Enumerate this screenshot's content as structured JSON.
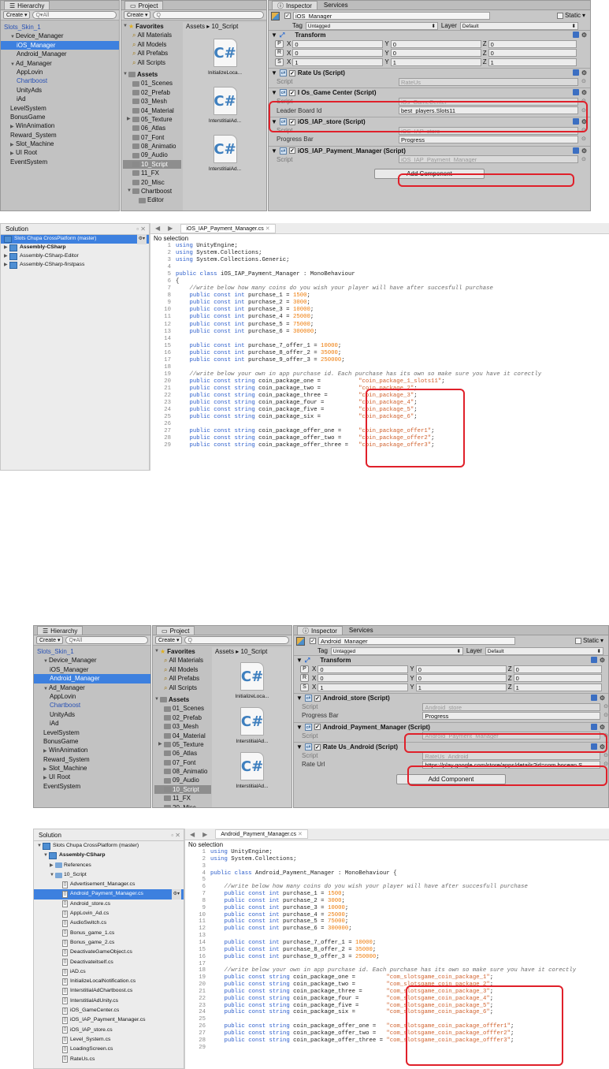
{
  "top": {
    "hierarchy": {
      "tab": "Hierarchy",
      "create": "Create",
      "search": "Q▾All",
      "items": [
        {
          "label": "Slots_Skin_1",
          "indent": 0,
          "style": "blue"
        },
        {
          "label": "Device_Manager",
          "indent": 1,
          "arrow": "▼"
        },
        {
          "label": "iOS_Manager",
          "indent": 2,
          "sel": true
        },
        {
          "label": "Android_Manager",
          "indent": 2
        },
        {
          "label": "Ad_Manager",
          "indent": 1,
          "arrow": "▼"
        },
        {
          "label": "AppLovin",
          "indent": 2
        },
        {
          "label": "Chartboost",
          "indent": 2,
          "style": "blue"
        },
        {
          "label": "UnityAds",
          "indent": 2
        },
        {
          "label": "iAd",
          "indent": 2
        },
        {
          "label": "LevelSystem",
          "indent": 1
        },
        {
          "label": "BonusGame",
          "indent": 1
        },
        {
          "label": "WinAnimation",
          "indent": 1,
          "arrow": "▶"
        },
        {
          "label": "Reward_System",
          "indent": 1
        },
        {
          "label": "Slot_Machine",
          "indent": 1,
          "arrow": "▶"
        },
        {
          "label": "UI Root",
          "indent": 1,
          "arrow": "▶"
        },
        {
          "label": "EventSystem",
          "indent": 1
        }
      ]
    },
    "project": {
      "tab": "Project",
      "create": "Create",
      "breadcrumb_root": "Assets",
      "breadcrumb_sep": "▸",
      "breadcrumb_leaf": "10_Script",
      "favorites": {
        "label": "Favorites",
        "items": [
          "All Materials",
          "All Models",
          "All Prefabs",
          "All Scripts"
        ]
      },
      "assets": {
        "label": "Assets",
        "items": [
          "01_Scenes",
          "02_Prefab",
          "03_Mesh",
          "04_Material",
          "05_Texture",
          "06_Atlas",
          "07_Font",
          "08_Animatio",
          "09_Audio",
          "10_Script",
          "11_FX",
          "20_Misc",
          "Chartboost",
          "Editor"
        ],
        "selected": "10_Script"
      },
      "files": [
        "InitializeLoca...",
        "InterstitialAd...",
        "InterstitialAd..."
      ]
    },
    "inspector": {
      "tab": "Inspector",
      "tab2": "Services",
      "name": "iOS_Manager",
      "static": "Static",
      "tag_label": "Tag",
      "tag": "Untagged",
      "layer_label": "Layer",
      "layer": "Default",
      "transform": {
        "title": "Transform",
        "rows": [
          {
            "k": "P",
            "x": "0",
            "y": "0",
            "z": "0"
          },
          {
            "k": "R",
            "x": "0",
            "y": "0",
            "z": "0"
          },
          {
            "k": "S",
            "x": "1",
            "y": "1",
            "z": "1"
          }
        ]
      },
      "components": [
        {
          "title": "Rate Us (Script)",
          "fields": [
            {
              "k": "Script",
              "v": "RateUs",
              "ro": true
            }
          ]
        },
        {
          "title": "I Os_Game Center (Script)",
          "fields": [
            {
              "k": "Script",
              "v": "iOs_GameCenter",
              "ro": true
            },
            {
              "k": "Leader Board Id",
              "v": "best_players.Slots11"
            }
          ]
        },
        {
          "title": "iOS_IAP_store (Script)",
          "fields": [
            {
              "k": "Script",
              "v": "iOS_IAP_store",
              "ro": true
            },
            {
              "k": "Progress Bar",
              "v": "Progress"
            }
          ]
        },
        {
          "title": "iOS_IAP_Payment_Manager (Script)",
          "fields": [
            {
              "k": "Script",
              "v": "iOS_IAP_Payment_Manager",
              "ro": true
            }
          ]
        }
      ],
      "add": "Add Component"
    }
  },
  "ide1": {
    "solution": "Solution",
    "root": "Slots Chupa CrossPlatform (master)",
    "projects": [
      "Assembly-CSharp",
      "Assembly-CSharp-Editor",
      "Assembly-CSharp-firstpass"
    ],
    "file_tab": "iOS_IAP_Payment_Manager.cs",
    "nosel": "No selection",
    "lines": [
      {
        "n": "1",
        "t": "using UnityEngine;"
      },
      {
        "n": "2",
        "t": "using System.Collections;"
      },
      {
        "n": "3",
        "t": "using System.Collections.Generic;"
      },
      {
        "n": "4",
        "t": ""
      },
      {
        "n": "5",
        "t": "public class iOS_IAP_Payment_Manager : MonoBehaviour"
      },
      {
        "n": "6",
        "t": "{"
      },
      {
        "n": "7",
        "t": "    //write below how many coins do you wish your player will have after succesfull purchase"
      },
      {
        "n": "8",
        "t": "    public const int purchase_1 = 1500;"
      },
      {
        "n": "9",
        "t": "    public const int purchase_2 = 3000;"
      },
      {
        "n": "10",
        "t": "    public const int purchase_3 = 10000;"
      },
      {
        "n": "11",
        "t": "    public const int purchase_4 = 25000;"
      },
      {
        "n": "12",
        "t": "    public const int purchase_5 = 75000;"
      },
      {
        "n": "13",
        "t": "    public const int purchase_6 = 300000;"
      },
      {
        "n": "14",
        "t": ""
      },
      {
        "n": "15",
        "t": "    public const int purchase_7_offer_1 = 10000;"
      },
      {
        "n": "16",
        "t": "    public const int purchase_8_offer_2 = 35000;"
      },
      {
        "n": "17",
        "t": "    public const int purchase_9_offer_3 = 250000;"
      },
      {
        "n": "18",
        "t": ""
      },
      {
        "n": "19",
        "t": "    //write below your own in app purchase id. Each purchase has its own so make sure you have it corectly"
      },
      {
        "n": "20",
        "t": "    public const string coin_package_one =           \"coin_package_1_slots11\";"
      },
      {
        "n": "21",
        "t": "    public const string coin_package_two =           \"coin_package_2\";"
      },
      {
        "n": "22",
        "t": "    public const string coin_package_three =         \"coin_package_3\";"
      },
      {
        "n": "23",
        "t": "    public const string coin_package_four =          \"coin_package_4\";"
      },
      {
        "n": "24",
        "t": "    public const string coin_package_five =          \"coin_package_5\";"
      },
      {
        "n": "25",
        "t": "    public const string coin_package_six =           \"coin_package_6\";"
      },
      {
        "n": "26",
        "t": ""
      },
      {
        "n": "27",
        "t": "    public const string coin_package_offer_one =     \"coin_package_offer1\";"
      },
      {
        "n": "28",
        "t": "    public const string coin_package_offer_two =     \"coin_package_offer2\";"
      },
      {
        "n": "29",
        "t": "    public const string coin_package_offer_three =   \"coin_package_offer3\";"
      }
    ]
  },
  "bottom": {
    "hierarchy": {
      "tab": "Hierarchy",
      "create": "Create",
      "search": "Q▾All",
      "items": [
        {
          "label": "Slots_Skin_1",
          "indent": 0,
          "style": "blue"
        },
        {
          "label": "Device_Manager",
          "indent": 1,
          "arrow": "▼"
        },
        {
          "label": "iOS_Manager",
          "indent": 2
        },
        {
          "label": "Android_Manager",
          "indent": 2,
          "sel": true
        },
        {
          "label": "Ad_Manager",
          "indent": 1,
          "arrow": "▼"
        },
        {
          "label": "AppLovin",
          "indent": 2
        },
        {
          "label": "Chartboost",
          "indent": 2,
          "style": "blue"
        },
        {
          "label": "UnityAds",
          "indent": 2
        },
        {
          "label": "iAd",
          "indent": 2
        },
        {
          "label": "LevelSystem",
          "indent": 1
        },
        {
          "label": "BonusGame",
          "indent": 1
        },
        {
          "label": "WinAnimation",
          "indent": 1,
          "arrow": "▶"
        },
        {
          "label": "Reward_System",
          "indent": 1
        },
        {
          "label": "Slot_Machine",
          "indent": 1,
          "arrow": "▶"
        },
        {
          "label": "UI Root",
          "indent": 1,
          "arrow": "▶"
        },
        {
          "label": "EventSystem",
          "indent": 1
        }
      ]
    },
    "project": {
      "tab": "Project",
      "create": "Create",
      "breadcrumb_root": "Assets",
      "breadcrumb_sep": "▸",
      "breadcrumb_leaf": "10_Script",
      "favorites": {
        "label": "Favorites",
        "items": [
          "All Materials",
          "All Models",
          "All Prefabs",
          "All Scripts"
        ]
      },
      "assets": {
        "label": "Assets",
        "items": [
          "01_Scenes",
          "02_Prefab",
          "03_Mesh",
          "04_Material",
          "05_Texture",
          "06_Atlas",
          "07_Font",
          "08_Animatio",
          "09_Audio",
          "10_Script",
          "11_FX",
          "20_Misc"
        ],
        "selected": "10_Script"
      },
      "files": [
        "InitializeLoca...",
        "InterstitialAd...",
        "InterstitialAd..."
      ]
    },
    "inspector": {
      "tab": "Inspector",
      "tab2": "Services",
      "name": "Android_Manager",
      "static": "Static",
      "tag_label": "Tag",
      "tag": "Untagged",
      "layer_label": "Layer",
      "layer": "Default",
      "transform": {
        "title": "Transform",
        "rows": [
          {
            "k": "P",
            "x": "0",
            "y": "0",
            "z": "0"
          },
          {
            "k": "R",
            "x": "0",
            "y": "0",
            "z": "0"
          },
          {
            "k": "S",
            "x": "1",
            "y": "1",
            "z": "1"
          }
        ]
      },
      "components": [
        {
          "title": "Android_store (Script)",
          "fields": [
            {
              "k": "Script",
              "v": "Android_store",
              "ro": true
            },
            {
              "k": "Progress Bar",
              "v": "Progress"
            }
          ]
        },
        {
          "title": "Android_Payment_Manager (Script)",
          "fields": [
            {
              "k": "Script",
              "v": "Android_Payment_Manager",
              "ro": true
            }
          ]
        },
        {
          "title": "Rate Us_Android (Script)",
          "fields": [
            {
              "k": "Script",
              "v": "RateUs_Android",
              "ro": true
            },
            {
              "k": "Rate Url",
              "v": "https://play.google.com/store/apps/details?id=com.bocean.S"
            }
          ]
        }
      ],
      "add": "Add Component"
    }
  },
  "ide2": {
    "solution": "Solution",
    "root": "Slots Chupa CrossPlatform (master)",
    "project": "Assembly-CSharp",
    "references": "References",
    "folder": "10_Script",
    "files": [
      "Advertisement_Manager.cs",
      "Android_Payment_Manager.cs",
      "Android_store.cs",
      "AppLovin_Ad.cs",
      "AudioSwitch.cs",
      "Bonus_game_1.cs",
      "Bonus_game_2.cs",
      "DeactivateGameObject.cs",
      "Deactivateitself.cs",
      "iAD.cs",
      "InitializeLocalNotification.cs",
      "InterstitialAdChartboost.cs",
      "InterstitialAdUnity.cs",
      "iOS_GameCenter.cs",
      "iOS_IAP_Payment_Manager.cs",
      "iOS_IAP_store.cs",
      "Level_System.cs",
      "LoadingScreen.cs",
      "RateUs.cs"
    ],
    "selected": "Android_Payment_Manager.cs",
    "file_tab": "Android_Payment_Manager.cs",
    "nosel": "No selection",
    "lines": [
      {
        "n": "1",
        "t": "using UnityEngine;"
      },
      {
        "n": "2",
        "t": "using System.Collections;"
      },
      {
        "n": "3",
        "t": ""
      },
      {
        "n": "4",
        "t": "public class Android_Payment_Manager : MonoBehaviour {"
      },
      {
        "n": "5",
        "t": ""
      },
      {
        "n": "6",
        "t": "    //write below how many coins do you wish your player will have after succesfull purchase"
      },
      {
        "n": "7",
        "t": "    public const int purchase_1 = 1500;"
      },
      {
        "n": "8",
        "t": "    public const int purchase_2 = 3000;"
      },
      {
        "n": "9",
        "t": "    public const int purchase_3 = 10000;"
      },
      {
        "n": "10",
        "t": "    public const int purchase_4 = 25000;"
      },
      {
        "n": "11",
        "t": "    public const int purchase_5 = 75000;"
      },
      {
        "n": "12",
        "t": "    public const int purchase_6 = 300000;"
      },
      {
        "n": "13",
        "t": ""
      },
      {
        "n": "14",
        "t": "    public const int purchase_7_offer_1 = 10000;"
      },
      {
        "n": "15",
        "t": "    public const int purchase_8_offer_2 = 35000;"
      },
      {
        "n": "16",
        "t": "    public const int purchase_9_offer_3 = 250000;"
      },
      {
        "n": "17",
        "t": ""
      },
      {
        "n": "18",
        "t": "    //write below your own in app purchase id. Each purchase has its own so make sure you have it corectly"
      },
      {
        "n": "19",
        "t": "    public const string coin_package_one =         \"com_slotsgame_coin_package_1\";"
      },
      {
        "n": "20",
        "t": "    public const string coin_package_two =         \"com_slotsgame_coin_package_2\";"
      },
      {
        "n": "21",
        "t": "    public const string coin_package_three =       \"com_slotsgame_coin_package_3\";"
      },
      {
        "n": "22",
        "t": "    public const string coin_package_four =        \"com_slotsgame_coin_package_4\";"
      },
      {
        "n": "23",
        "t": "    public const string coin_package_five =        \"com_slotsgame_coin_package_5\";"
      },
      {
        "n": "24",
        "t": "    public const string coin_package_six =         \"com_slotsgame_coin_package_6\";"
      },
      {
        "n": "25",
        "t": ""
      },
      {
        "n": "26",
        "t": "    public const string coin_package_offer_one =   \"com_slotsgame_coin_package_offfer1\";"
      },
      {
        "n": "27",
        "t": "    public const string coin_package_offer_two =   \"com_slotsgame_coin_package_offfer2\";"
      },
      {
        "n": "28",
        "t": "    public const string coin_package_offer_three = \"com_slotsgame_coin_package_offfer3\";"
      },
      {
        "n": "29",
        "t": ""
      }
    ]
  }
}
